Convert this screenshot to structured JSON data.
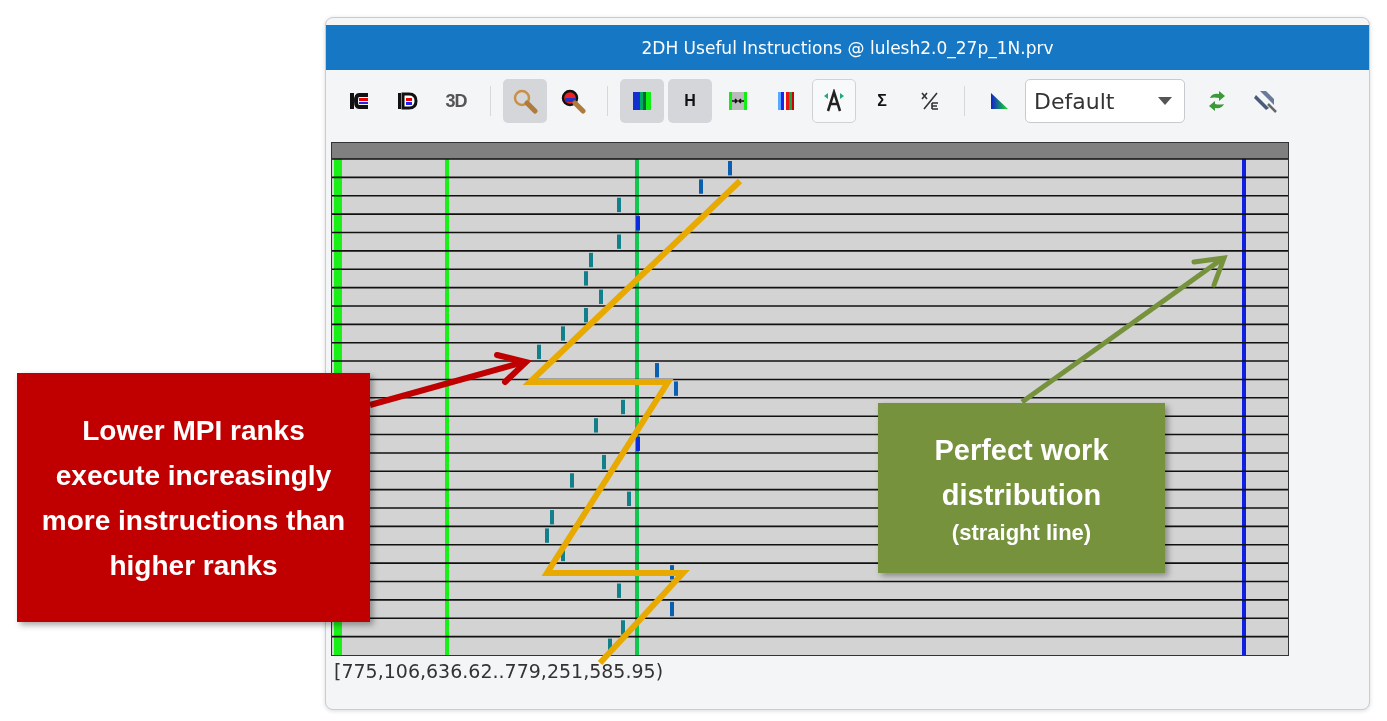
{
  "window": {
    "title": "2DH Useful Instructions @ lulesh2.0_27p_1N.prv"
  },
  "toolbar": {
    "tools": [
      {
        "kind": "code-view",
        "selected": false
      },
      {
        "kind": "data-view",
        "selected": false
      },
      {
        "kind": "dimension",
        "label": "3D",
        "selected": false
      },
      {
        "kind": "separator"
      },
      {
        "kind": "zoom",
        "selected": true
      },
      {
        "kind": "zoom-colored",
        "selected": false
      },
      {
        "kind": "separator"
      },
      {
        "kind": "gradient",
        "selected": true
      },
      {
        "kind": "letter",
        "label": "H",
        "selected": true
      },
      {
        "kind": "compress",
        "selected": false
      },
      {
        "kind": "colors",
        "selected": false
      },
      {
        "kind": "labels",
        "outlined": true
      },
      {
        "kind": "letter",
        "label": "Σ",
        "selected": false
      },
      {
        "kind": "fraction",
        "selected": false
      },
      {
        "kind": "separator"
      },
      {
        "kind": "palette",
        "selected": false
      }
    ],
    "dropdown": {
      "value": "Default"
    },
    "after": [
      {
        "kind": "sync"
      },
      {
        "kind": "pin"
      }
    ]
  },
  "status_bar": {
    "text": "[775,106,636.62..779,251,585.95)"
  },
  "callouts": [
    {
      "color": "#c00000",
      "text": "Lower MPI ranks execute increasingly more instructions than higher ranks"
    },
    {
      "color": "#76923c",
      "text": "Perfect work distribution",
      "note": "(straight line)"
    }
  ]
}
